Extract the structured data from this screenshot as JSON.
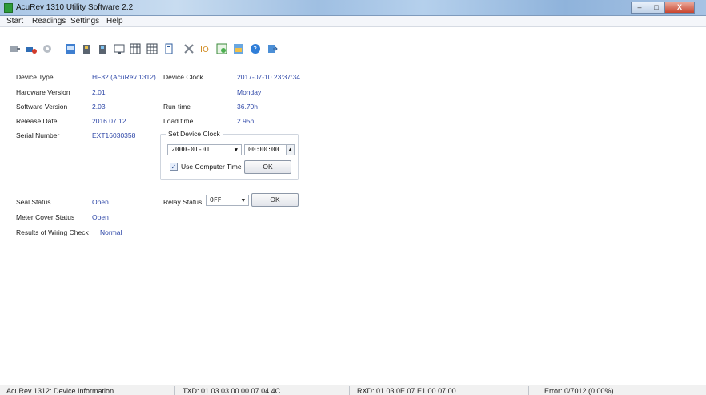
{
  "window": {
    "title": "AcuRev 1310 Utility Software 2.2",
    "close_label": "X"
  },
  "menu": [
    "Start",
    "Readings",
    "Settings",
    "Help"
  ],
  "toolbar": {
    "icons": [
      "connect-icon",
      "disconnect-icon",
      "settings-gear-icon",
      "device-info-icon",
      "energy-icon",
      "demand-icon",
      "monitor-icon",
      "calendar-icon",
      "calendar-grid-icon",
      "document-icon",
      "tools-icon",
      "io-icon",
      "schedule-icon",
      "image-icon",
      "help-icon",
      "exit-icon"
    ]
  },
  "device": {
    "labels": {
      "device_type": "Device Type",
      "hardware_version": "Hardware Version",
      "software_version": "Software Version",
      "release_date": "Release Date",
      "serial_number": "Serial Number",
      "device_clock": "Device Clock",
      "run_time": "Run time",
      "load_time": "Load time",
      "seal_status": "Seal Status",
      "meter_cover_status": "Meter Cover Status",
      "wiring_check": "Results of Wiring Check",
      "relay_status": "Relay Status"
    },
    "values": {
      "device_type": "HF32 (AcuRev 1312)",
      "hardware_version": "2.01",
      "software_version": "2.03",
      "release_date": "2016 07 12",
      "serial_number": "EXT16030358",
      "device_clock": "2017-07-10 23:37:34",
      "device_day": "Monday",
      "run_time": "36.70h",
      "load_time": "2.95h",
      "seal_status": "Open",
      "meter_cover_status": "Open",
      "wiring_check": "Normal"
    }
  },
  "set_clock": {
    "title": "Set Device Clock",
    "date": "2000-01-01",
    "time": "00:00:00",
    "use_computer_time_label": "Use Computer Time",
    "use_computer_time_checked": true,
    "ok_label": "OK"
  },
  "relay": {
    "selected": "OFF",
    "ok_label": "OK"
  },
  "statusbar": {
    "page": "AcuRev 1312: Device Information",
    "txd": "TXD: 01 03 03 00 00 07 04 4C",
    "rxd": "RXD: 01 03 0E 07 E1 00 07 00 ..",
    "error": "Error: 0/7012 (0.00%)"
  }
}
